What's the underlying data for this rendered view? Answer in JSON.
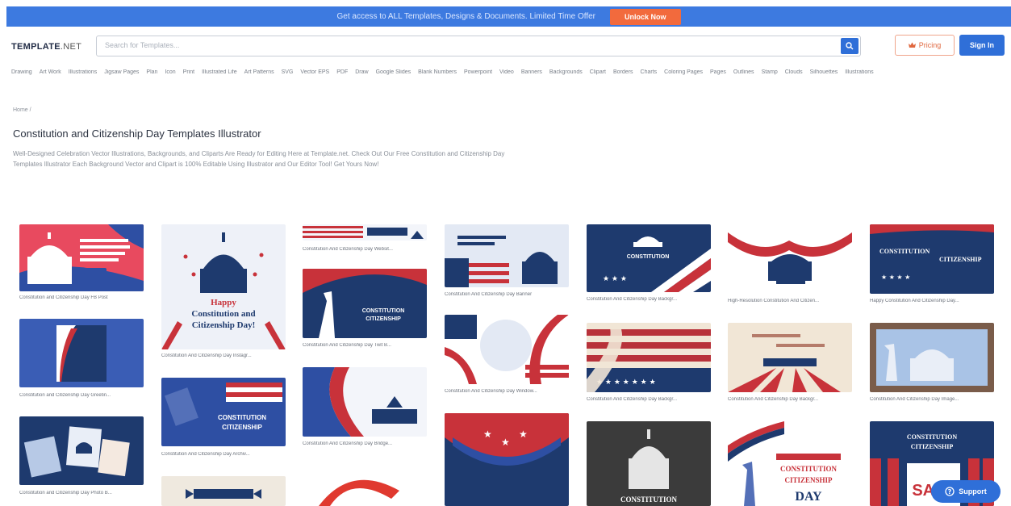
{
  "promo": {
    "text": "Get access to ALL Templates, Designs & Documents. Limited Time Offer",
    "button": "Unlock Now"
  },
  "header": {
    "logo_main": "TEMPLATE",
    "logo_suffix": ".NET",
    "search_placeholder": "Search for Templates...",
    "pricing_label": "Pricing",
    "signin_label": "Sign In"
  },
  "categories": [
    "Drawing",
    "Art Work",
    "Illustrations",
    "Jigsaw Pages",
    "Plan",
    "Icon",
    "Print",
    "Illustrated Life",
    "Art Patterns",
    "SVG",
    "Vector EPS",
    "PDF",
    "Draw",
    "Google Slides",
    "Blank Numbers",
    "Powerpoint",
    "Video",
    "Banners",
    "Backgrounds",
    "Clipart",
    "Borders",
    "Charts",
    "Coloring Pages",
    "Pages",
    "Outlines",
    "Stamp",
    "Clouds",
    "Silhouettes",
    "Illustrations"
  ],
  "breadcrumb": "Home /",
  "page": {
    "title": "Constitution and Citizenship Day Templates Illustrator",
    "description": "Well-Designed Celebration Vector Illustrations, Backgrounds, and Cliparts Are Ready for Editing Here at Template.net. Check Out Our Free Constitution and Citizenship Day Templates Illustrator Each Background Vector and Clipart is 100% Editable Using Illustrator and Our Editor Tool! Get Yours Now!"
  },
  "templates": [
    {
      "caption": "Constitution and Citizenship Day FB Post"
    },
    {
      "caption": "Constitution and Citizenship Day Greetin..."
    },
    {
      "caption": "Constitution and Citizenship Day Photo B..."
    },
    {
      "caption": "Constitution And Citizenship Day Instagr..."
    },
    {
      "caption": "Constitution And Citizenship Day Archiv..."
    },
    {
      "caption": "Constitution And Citizenship Day Websit..."
    },
    {
      "caption": "Constitution And Citizenship Day Twit B..."
    },
    {
      "caption": "Constitution And Citizenship Day Bridge..."
    },
    {
      "caption": "Constitution And Citizenship Day Banner"
    },
    {
      "caption": "Constitution And Citizenship Day Window..."
    },
    {
      "caption": "Constitution And Citizenship Day Backgr..."
    },
    {
      "caption": "Constitution And Citizenship Day Backgr..."
    },
    {
      "caption": "High-Resolution Constitution And Citizen..."
    },
    {
      "caption": "Constitution And Citizenship Day Backgr..."
    },
    {
      "caption": "Happy Constitution And Citizenship Day..."
    },
    {
      "caption": "Constitution And Citizenship Day Image..."
    }
  ],
  "art_text": {
    "happy": "Happy",
    "const_and": "Constitution and",
    "citizenship_day": "Citizenship Day!",
    "constitution": "CONSTITUTION",
    "citizenship": "CITIZENSHIP",
    "day": "DAY",
    "cc_day": "CONSTITUTION AND CITIZENSHIP DAY",
    "sale": "SALE"
  },
  "support_label": "Support",
  "colors": {
    "brand_blue": "#3d7ae0",
    "accent_orange": "#f26a3d",
    "navy": "#1e3a6e",
    "red": "#c8323a"
  }
}
